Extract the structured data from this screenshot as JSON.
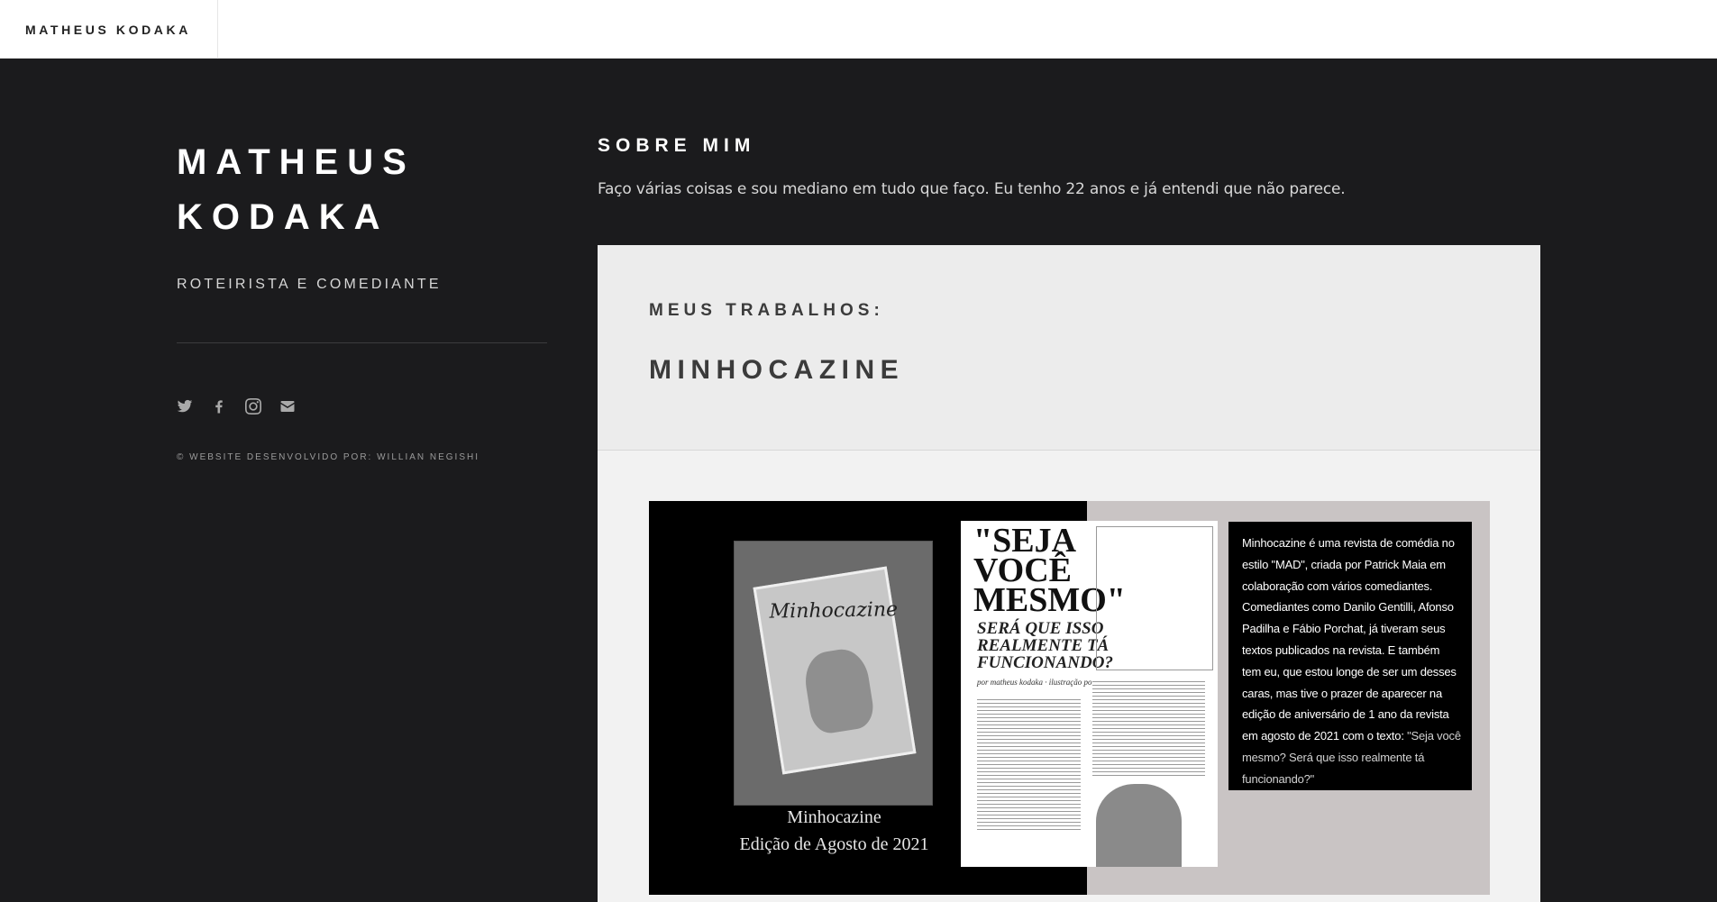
{
  "header": {
    "brand": "MATHEUS KODAKA"
  },
  "sidebar": {
    "title_line1": "MATHEUS",
    "title_line2": "KODAKA",
    "subtitle": "ROTEIRISTA E COMEDIANTE",
    "socials": [
      "twitter-icon",
      "facebook-icon",
      "instagram-icon",
      "envelope-icon"
    ],
    "credit": "© WEBSITE DESENVOLVIDO POR: WILLIAN NEGISHI"
  },
  "about": {
    "heading": "SOBRE MIM",
    "text": "Faço várias coisas e sou mediano em tudo que faço. Eu tenho 22 anos e já entendi que não parece."
  },
  "works": {
    "subheading": "MEUS TRABALHOS:",
    "title": "MINHOCAZINE",
    "image": {
      "cover_name": "Minhocazine",
      "caption_line1": "Minhocazine",
      "caption_line2": "Edição de Agosto de 2021",
      "page_headline": "\"SEJA VOCÊ MESMO\"",
      "page_subheadline": "SERÁ QUE ISSO REALMENTE TÁ FUNCIONANDO?",
      "page_credit": "por matheus kodaka · ilustração por kleverson mariano",
      "description": "Minhocazine é uma revista de comédia no estilo \"MAD\", criada por Patrick Maia em colaboração com vários comediantes. Comediantes como Danilo Gentilli, Afonso Padilha e Fábio Porchat, já tiveram seus textos publicados na revista. E também tem eu, que estou longe de ser um desses caras, mas tive o prazer de aparecer na edição de aniversário de 1 ano da revista em agosto de 2021 com o texto: ",
      "description_highlight": "\"Seja você mesmo? Será que isso realmente tá funcionando?\""
    }
  },
  "colors": {
    "background": "#1b1b1d",
    "header_bg": "#ffffff",
    "card_bg": "#ececec"
  }
}
